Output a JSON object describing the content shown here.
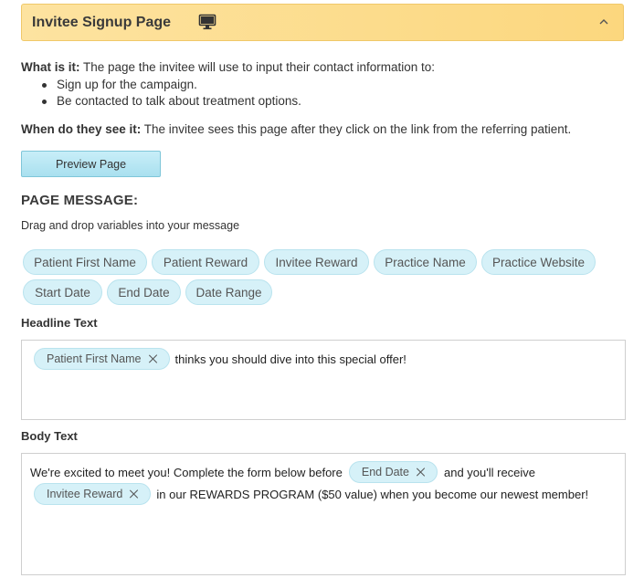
{
  "header": {
    "title": "Invitee Signup Page",
    "monitor_icon": "monitor-icon",
    "collapse_icon": "chevron-up-icon"
  },
  "what_is_it": {
    "label": "What is it:",
    "text": "The page the invitee will use to input their contact information to:",
    "bullets": [
      "Sign up for the campaign.",
      "Be contacted to talk about treatment options."
    ]
  },
  "when_see": {
    "label": "When do they see it:",
    "text": "The invitee sees this page after they click on the link from the referring patient."
  },
  "preview_button": "Preview Page",
  "page_message": {
    "title": "PAGE MESSAGE:",
    "instructions": "Drag and drop variables into your message"
  },
  "variables": [
    "Patient First Name",
    "Patient Reward",
    "Invitee Reward",
    "Practice Name",
    "Practice Website",
    "Start Date",
    "End Date",
    "Date Range"
  ],
  "headline": {
    "label": "Headline Text",
    "token": "Patient First Name",
    "text_after": "thinks you should dive into this special offer!"
  },
  "body": {
    "label": "Body Text",
    "line1_before": "We're excited to meet you! Complete the form below before",
    "line1_token": "End Date",
    "line1_after": "and you'll receive",
    "line2_token": "Invitee Reward",
    "line2_after": "in our REWARDS PROGRAM ($50 value) when you become our newest member!"
  },
  "colors": {
    "header_bg": "#fcd77e",
    "chip_bg": "#d6f1f8",
    "button_bg": "#a9e0ef"
  }
}
